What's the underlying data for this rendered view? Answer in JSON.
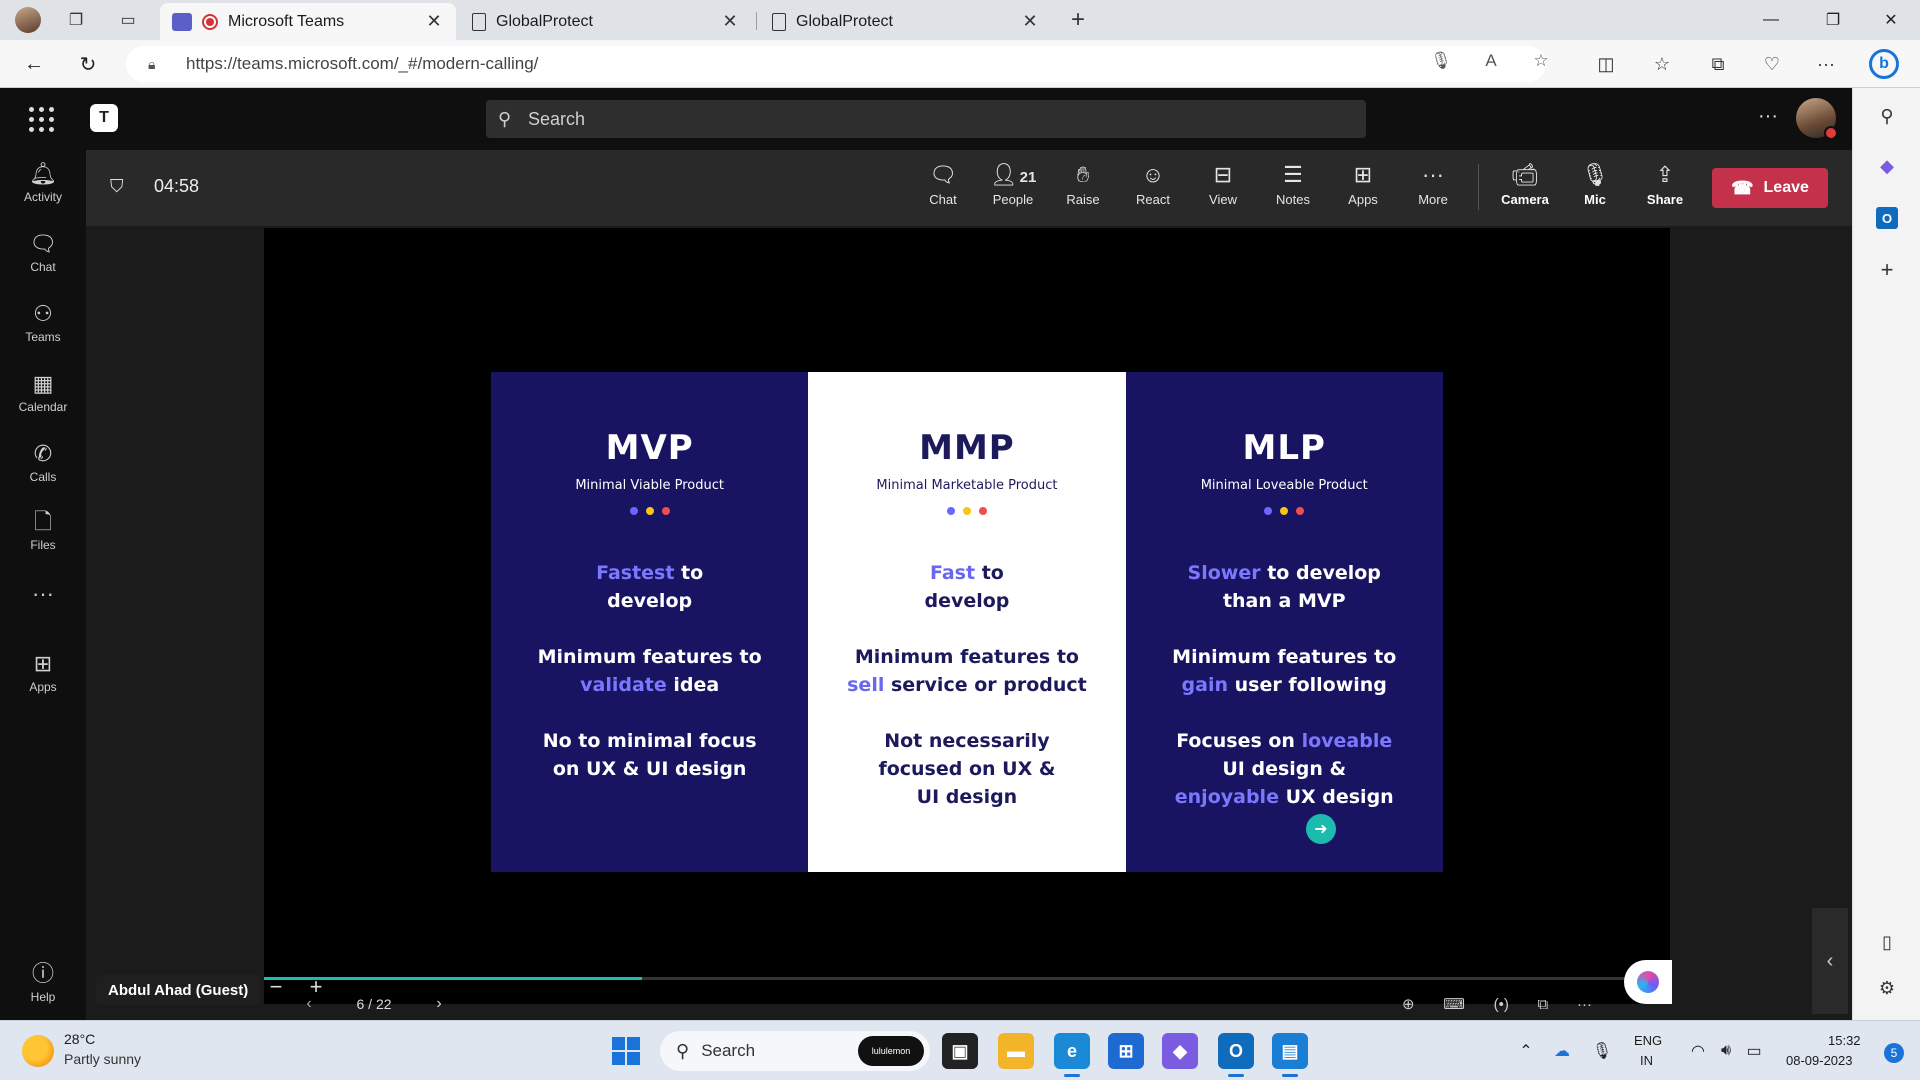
{
  "browser": {
    "tabs": [
      {
        "title": "Microsoft Teams",
        "active": true
      },
      {
        "title": "GlobalProtect",
        "active": false
      },
      {
        "title": "GlobalProtect",
        "active": false
      }
    ],
    "new_tab_label": "+",
    "url": "https://teams.microsoft.com/_#/modern-calling/"
  },
  "teams": {
    "search_placeholder": "Search",
    "rail": [
      {
        "label": "Activity",
        "icon": "bell-icon"
      },
      {
        "label": "Chat",
        "icon": "chat-icon"
      },
      {
        "label": "Teams",
        "icon": "teams-icon"
      },
      {
        "label": "Calendar",
        "icon": "calendar-icon"
      },
      {
        "label": "Calls",
        "icon": "phone-icon"
      },
      {
        "label": "Files",
        "icon": "file-icon"
      },
      {
        "label": "",
        "icon": "more-icon"
      },
      {
        "label": "Apps",
        "icon": "apps-icon"
      }
    ],
    "help_label": "Help"
  },
  "meeting": {
    "timer": "04:58",
    "controls": [
      {
        "label": "Chat",
        "icon": "chat-icon"
      },
      {
        "label": "People",
        "icon": "people-icon"
      },
      {
        "label": "Raise",
        "icon": "hand-icon"
      },
      {
        "label": "React",
        "icon": "smile-icon"
      },
      {
        "label": "View",
        "icon": "view-icon"
      },
      {
        "label": "Notes",
        "icon": "notes-icon"
      },
      {
        "label": "Apps",
        "icon": "add-app-icon"
      },
      {
        "label": "More",
        "icon": "more-icon"
      },
      {
        "label": "Camera",
        "icon": "camera-off-icon"
      },
      {
        "label": "Mic",
        "icon": "mic-off-icon"
      },
      {
        "label": "Share",
        "icon": "share-icon"
      }
    ],
    "people_count": "21",
    "leave_label": "Leave",
    "presenter": "Abdul Ahad (Guest)",
    "slide_counter": "6 / 22",
    "slide_progress_fraction": 0.272
  },
  "slide": {
    "panels": [
      {
        "title": "MVP",
        "subtitle": "Minimal Viable Product",
        "l1_hl": "Fastest",
        "l1_rest": " to",
        "l1_b": "develop",
        "l2_a": "Minimum features to",
        "l2_hl": "validate",
        "l2_rest": " idea",
        "l3_a": "No to minimal focus",
        "l3_b": "on UX & UI design"
      },
      {
        "title": "MMP",
        "subtitle": "Minimal Marketable Product",
        "l1_hl": "Fast",
        "l1_rest": " to",
        "l1_b": "develop",
        "l2_a": "Minimum features to",
        "l2_hl": "sell",
        "l2_rest": " service or product",
        "l3_a": "Not necessarily",
        "l3_b": "focused on UX &",
        "l3_c": "UI design"
      },
      {
        "title": "MLP",
        "subtitle": "Minimal Loveable Product",
        "l1_hl": "Slower",
        "l1_rest": " to develop",
        "l1_b": "than a MVP",
        "l2_a": "Minimum features to",
        "l2_hl": "gain",
        "l2_rest": " user following",
        "l3_a": "Focuses on ",
        "l3_hl": "loveable",
        "l3_b": "UI design &",
        "l3_hl2": "enjoyable",
        "l3_c": " UX design"
      }
    ],
    "dot_colors": [
      "#6b66ff",
      "#f5c518",
      "#f04e4e"
    ]
  },
  "taskbar": {
    "weather_temp": "28°C",
    "weather_desc": "Partly sunny",
    "search_placeholder": "Search",
    "search_badge": "lululemon",
    "lang_1": "ENG",
    "lang_2": "IN",
    "time": "15:32",
    "date": "08-09-2023",
    "notifications": "5"
  }
}
